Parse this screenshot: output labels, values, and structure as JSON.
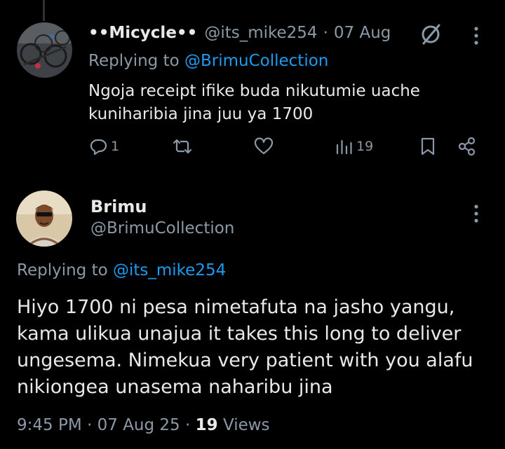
{
  "reply1": {
    "display_name": "••Micycle••",
    "handle": "@its_mike254",
    "separator": "·",
    "date": "07 Aug",
    "replying_prefix": "Replying to",
    "replying_handle": "@BrimuCollection",
    "text": "Ngoja receipt ifike buda nikutumie uache kuniharibia jina juu ya 1700",
    "replies_count": "1",
    "views_count": "19"
  },
  "tweet": {
    "display_name": "Brimu",
    "handle": "@BrimuCollection",
    "replying_prefix": "Replying to",
    "replying_handle": "@its_mike254",
    "text": "Hiyo 1700 ni pesa nimetafuta na jasho yangu, kama ulikua unajua it takes this long to deliver ungesema.  Nimekua very patient with you alafu nikiongea unasema naharibu jina",
    "time": "9:45 PM",
    "sep1": "·",
    "date": "07 Aug 25",
    "sep2": "·",
    "views_count": "19",
    "views_label": "Views"
  },
  "colors": {
    "background": "#000000",
    "text": "#e7e9ea",
    "muted": "#8b98a5",
    "link": "#1d9bf0"
  },
  "icons": [
    "mute-icon",
    "more-icon",
    "reply-icon",
    "retweet-icon",
    "like-icon",
    "views-icon",
    "bookmark-icon",
    "share-icon"
  ]
}
